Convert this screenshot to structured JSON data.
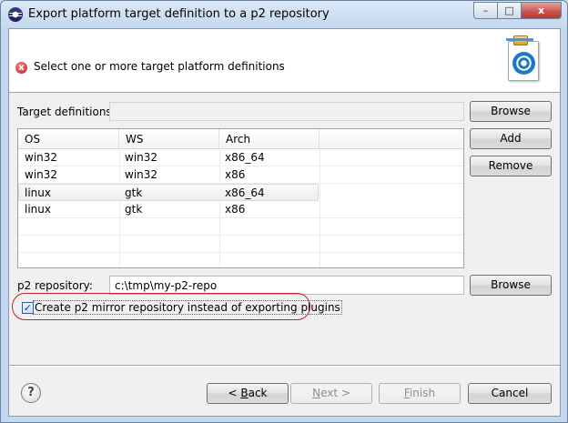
{
  "window": {
    "title": "Export platform target definition to a p2 repository",
    "min_glyph": "–",
    "max_glyph": "□",
    "close_glyph": "x"
  },
  "header": {
    "error_glyph": "x",
    "message": "Select one or more target platform definitions"
  },
  "form": {
    "target_label": "Target definitions:",
    "target_value": "",
    "browse_label": "Browse",
    "add_label": "Add",
    "remove_label": "Remove",
    "repo_label": "p2 repository:",
    "repo_value": "c:\\tmp\\my-p2-repo",
    "repo_browse_label": "Browse",
    "mirror_label": "Create p2 mirror repository instead of exporting plugins",
    "mirror_checked": true,
    "check_glyph": "✓"
  },
  "table": {
    "columns": [
      "OS",
      "WS",
      "Arch"
    ],
    "rows": [
      [
        "win32",
        "win32",
        "x86_64"
      ],
      [
        "win32",
        "win32",
        "x86"
      ],
      [
        "linux",
        "gtk",
        "x86_64"
      ],
      [
        "linux",
        "gtk",
        "x86"
      ]
    ],
    "selected_row": 2
  },
  "footer": {
    "help_glyph": "?",
    "back_prefix": "< ",
    "back_mnemonic": "B",
    "back_rest": "ack",
    "next_mnemonic": "N",
    "next_rest": "ext >",
    "finish_mnemonic": "F",
    "finish_rest": "inish",
    "cancel_label": "Cancel"
  }
}
